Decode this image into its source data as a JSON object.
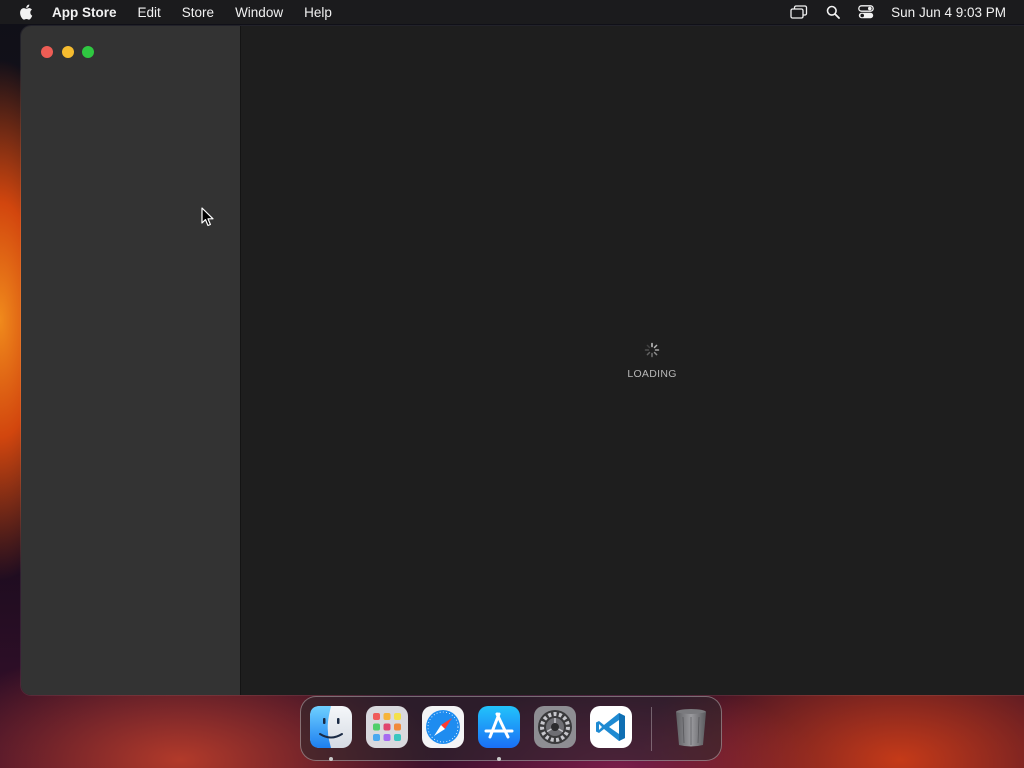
{
  "menubar": {
    "app_name": "App Store",
    "items": [
      "Edit",
      "Store",
      "Window",
      "Help"
    ],
    "clock": "Sun Jun 4  9:03 PM",
    "icons": [
      "screen-mirroring-icon",
      "search-icon",
      "control-center-icon"
    ]
  },
  "window": {
    "traffic_lights": [
      "close",
      "minimize",
      "zoom"
    ],
    "main": {
      "loading_text": "LOADING"
    }
  },
  "dock": {
    "apps": [
      {
        "name": "Finder",
        "icon": "finder-icon",
        "running": true
      },
      {
        "name": "Launchpad",
        "icon": "launchpad-icon",
        "running": false
      },
      {
        "name": "Safari",
        "icon": "safari-icon",
        "running": false
      },
      {
        "name": "App Store",
        "icon": "app-store-icon",
        "running": true
      },
      {
        "name": "System Settings",
        "icon": "system-settings-icon",
        "running": false
      },
      {
        "name": "Visual Studio Code",
        "icon": "vscode-icon",
        "running": false
      }
    ],
    "trash": {
      "name": "Trash",
      "icon": "trash-icon"
    }
  },
  "colors": {
    "menubar": "#1b1b1d",
    "sidebar": "#333333",
    "main": "#1e1e1e",
    "close": "#ee5d55",
    "minimize": "#f6bc2f",
    "zoom": "#2fc841"
  }
}
